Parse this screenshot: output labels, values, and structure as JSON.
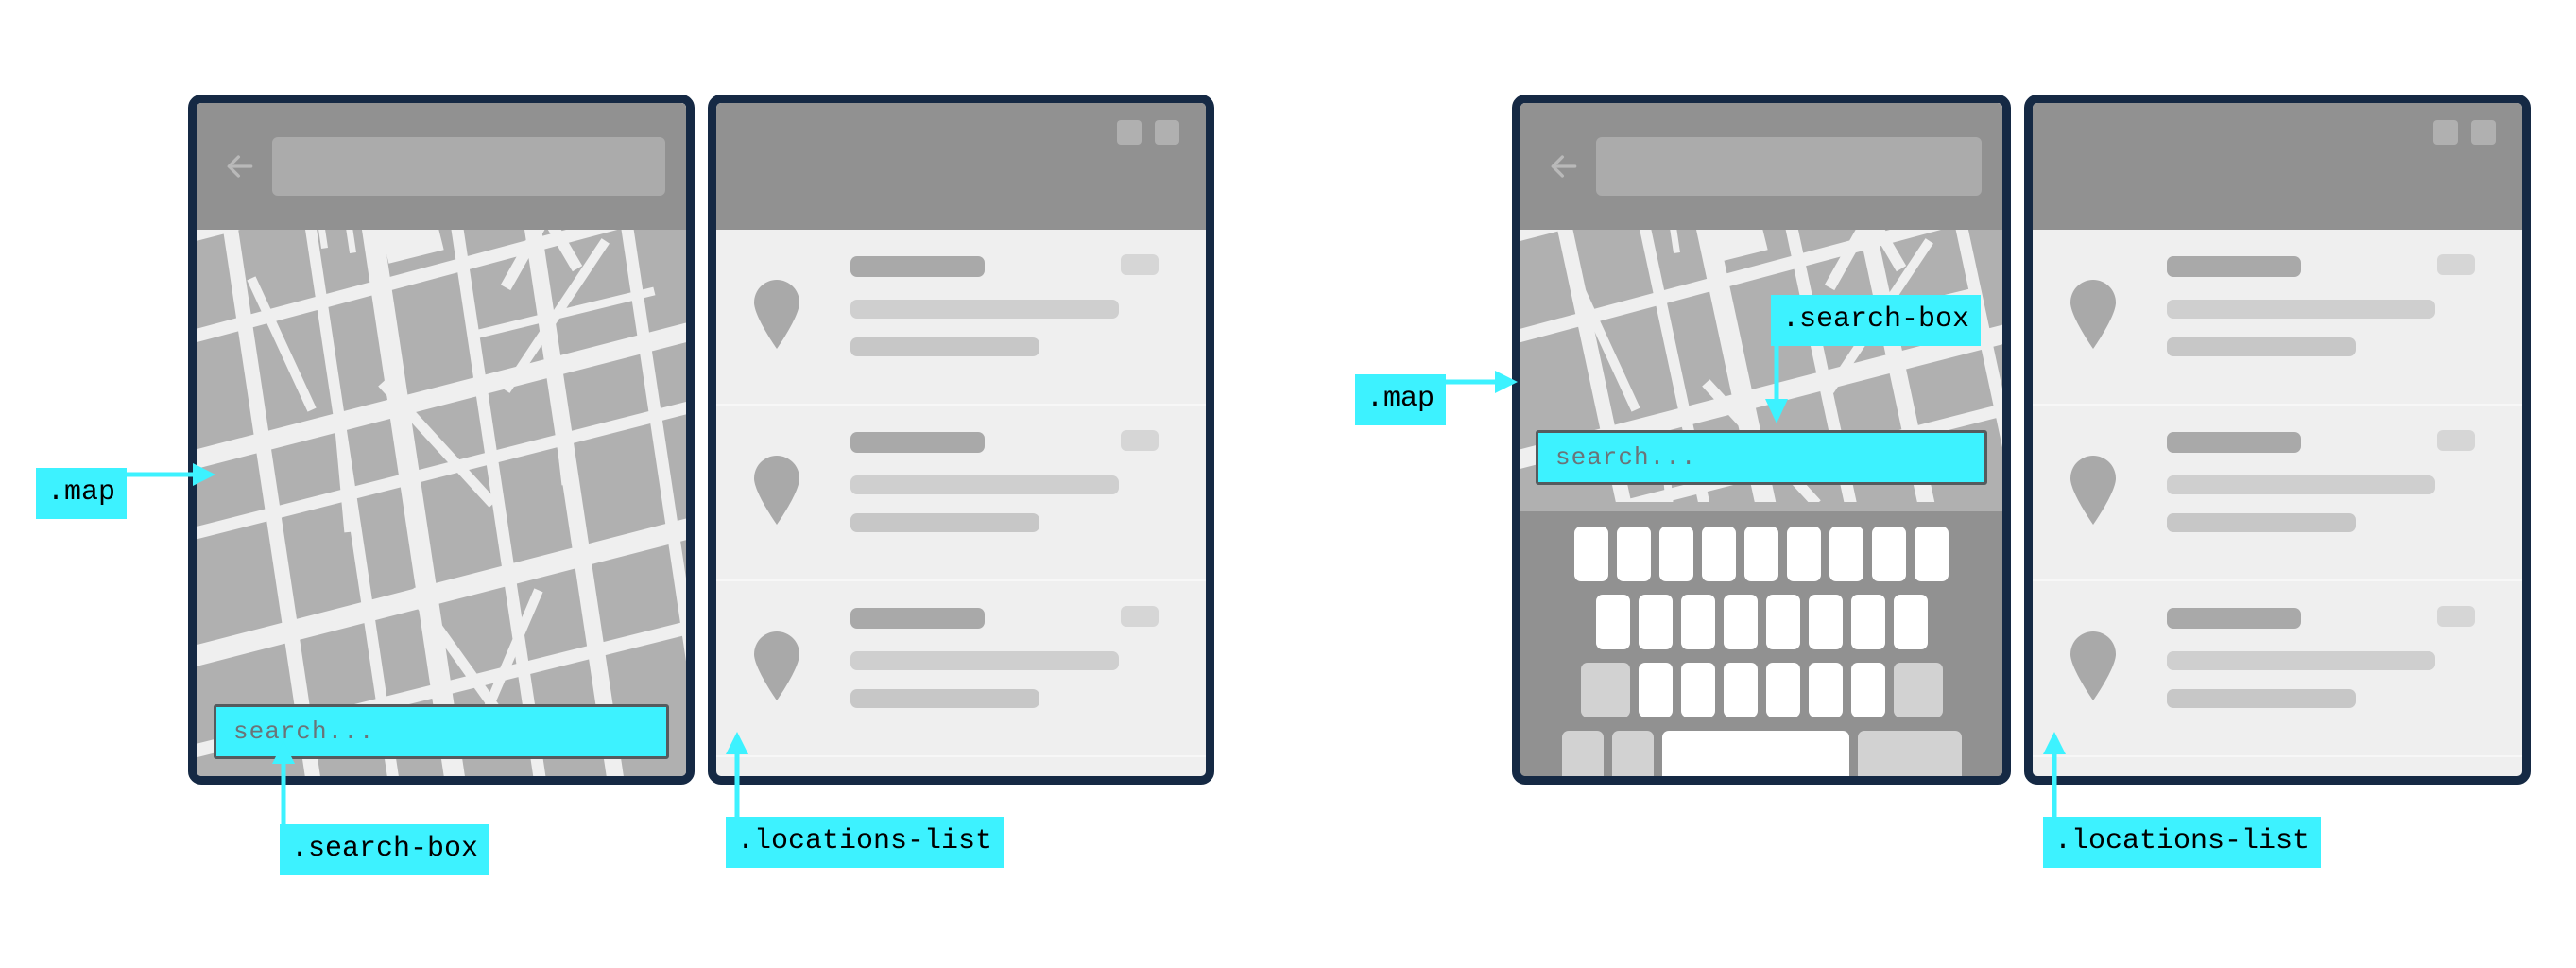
{
  "meta": {
    "accent": "#3df2ff",
    "frame_color": "#152944",
    "chrome_gray": "#919191",
    "map_land": "#b0b0b0",
    "map_road": "#efefef",
    "list_bg": "#efefef"
  },
  "annotations": {
    "map_left": ".map",
    "search_box_left": ".search-box",
    "locations_list_left": ".locations-list",
    "map_right": ".map",
    "search_box_right": ".search-box",
    "locations_list_right": ".locations-list"
  },
  "search": {
    "placeholder": "search..."
  },
  "icons": {
    "back": "back-arrow-icon",
    "pin": "map-pin-icon",
    "window_controls": [
      "minimize-box-icon",
      "maximize-box-icon"
    ]
  },
  "locations_list": {
    "rows": [
      {
        "title": "",
        "line1": "",
        "line2": "",
        "chip": ""
      },
      {
        "title": "",
        "line1": "",
        "line2": "",
        "chip": ""
      },
      {
        "title": "",
        "line1": "",
        "line2": "",
        "chip": ""
      }
    ]
  },
  "keyboard": {
    "rows": [
      {
        "keys": 9,
        "style": "letter"
      },
      {
        "keys": 8,
        "style": "letter"
      },
      {
        "keys": 9,
        "style": "letter-with-modifiers"
      },
      {
        "keys": 4,
        "style": "bottom"
      }
    ]
  },
  "states": {
    "left_label": "map screen with collapsed search",
    "right_label": "map screen with keyboard open"
  }
}
